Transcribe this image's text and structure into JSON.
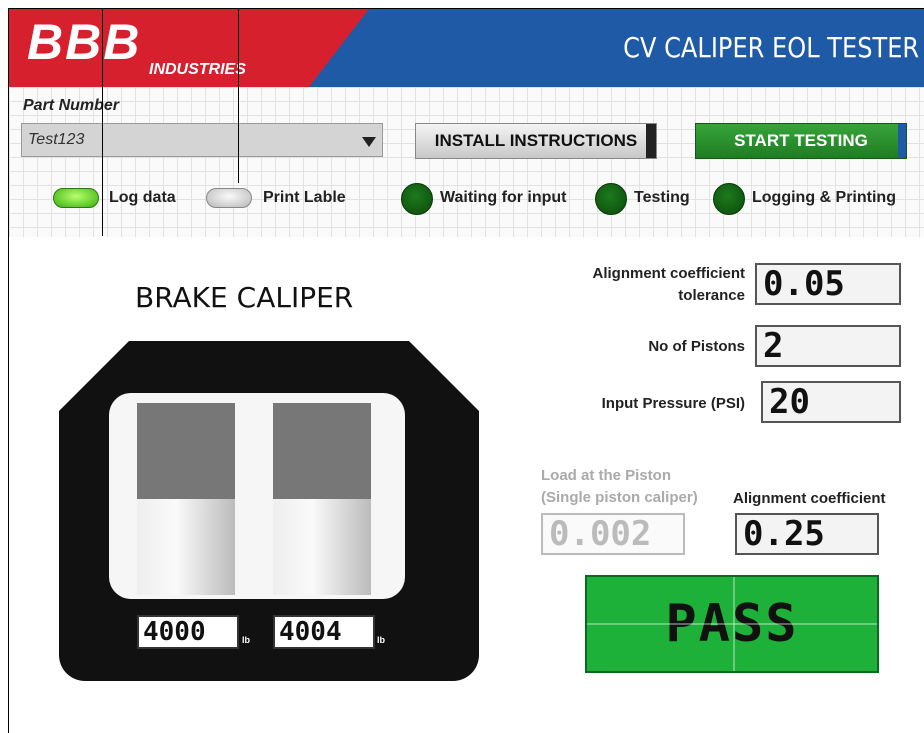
{
  "header": {
    "logo_text": "BBB",
    "logo_sub": "INDUSTRIES",
    "title": "CV CALIPER EOL TESTER",
    "colors": {
      "logo_red": "#d7202e",
      "header_blue": "#1f5aa6"
    }
  },
  "part_number": {
    "label": "Part Number",
    "value": "Test123"
  },
  "buttons": {
    "install": "INSTALL INSTRUCTIONS",
    "start": "START TESTING"
  },
  "toggles": [
    {
      "label": "Log data",
      "state": "on"
    },
    {
      "label": "Print Lable",
      "state": "off"
    }
  ],
  "indicators": [
    {
      "label": "Waiting for input",
      "color": "#1d7a1d"
    },
    {
      "label": "Testing",
      "color": "#1d7a1d"
    },
    {
      "label": "Logging & Printing",
      "color": "#1d7a1d"
    }
  ],
  "caliper": {
    "title": "BRAKE CALIPER",
    "pistons": [
      {
        "load": "4000",
        "unit": "lb",
        "level": 0.5
      },
      {
        "load": "4004",
        "unit": "lb",
        "level": 0.5
      }
    ]
  },
  "fields": {
    "tolerance": {
      "label_line1": "Alignment coefficient",
      "label_line2": "tolerance",
      "value": "0.05"
    },
    "pistons": {
      "label": "No of Pistons",
      "value": "2"
    },
    "pressure": {
      "label": "Input Pressure (PSI)",
      "value": "20"
    },
    "load": {
      "label_line1": "Load at the Piston",
      "label_line2": "(Single piston caliper)",
      "value": "0.002"
    },
    "coefficient": {
      "label": "Alignment coefficient",
      "value": "0.25"
    }
  },
  "result": {
    "text": "PASS",
    "color": "#1eb13a"
  }
}
